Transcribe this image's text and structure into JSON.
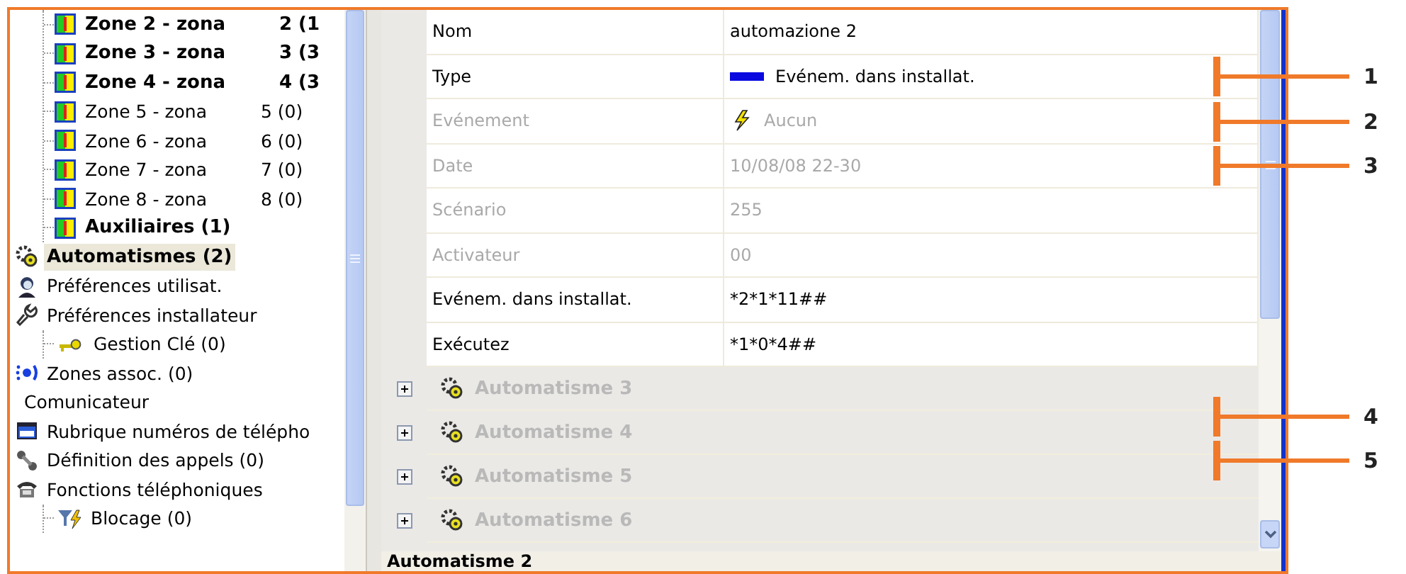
{
  "tree": {
    "continued_children": [
      {
        "label": "Zone 2 - zona",
        "count": "2 (1",
        "bold": true,
        "kind": "zone",
        "selected": false
      },
      {
        "label": "Zone 3 - zona",
        "count": "3 (3",
        "bold": true,
        "kind": "zone",
        "selected": false
      },
      {
        "label": "Zone 4 - zona",
        "count": "4 (3",
        "bold": true,
        "kind": "zone",
        "selected": false
      },
      {
        "label": "Zone 5 - zona",
        "count": "5 (0)",
        "bold": false,
        "kind": "zone",
        "selected": false
      },
      {
        "label": "Zone 6 - zona",
        "count": "6 (0)",
        "bold": false,
        "kind": "zone",
        "selected": false
      },
      {
        "label": "Zone 7 - zona",
        "count": "7 (0)",
        "bold": false,
        "kind": "zone",
        "selected": false
      },
      {
        "label": "Zone 8 - zona",
        "count": "8 (0)",
        "bold": false,
        "kind": "zone",
        "selected": false
      },
      {
        "label": "Auxiliaires (1)",
        "bold": true,
        "kind": "zone",
        "selected": false
      }
    ],
    "items": [
      {
        "label": "Automatismes (2)",
        "bold": true,
        "kind": "automation",
        "selected": true
      },
      {
        "label": "Préférences utilisat.",
        "bold": false,
        "kind": "user",
        "selected": false
      },
      {
        "label": "Préférences installateur",
        "bold": false,
        "kind": "wrench",
        "selected": false,
        "children": [
          {
            "label": "Gestion Clé (0)",
            "bold": false,
            "kind": "key",
            "selected": false
          }
        ]
      },
      {
        "label": "Zones assoc. (0)",
        "bold": false,
        "kind": "zones",
        "selected": false
      },
      {
        "label": "Comunicateur",
        "bold": false,
        "kind": "plain",
        "selected": false
      },
      {
        "label": "Rubrique numéros de télépho",
        "bold": false,
        "kind": "folder",
        "selected": false
      },
      {
        "label": "Définition des appels (0)",
        "bold": false,
        "kind": "calls",
        "selected": false
      },
      {
        "label": "Fonctions téléphoniques",
        "bold": false,
        "kind": "phone",
        "selected": false,
        "children": [
          {
            "label": "Blocage (0)",
            "bold": false,
            "kind": "filter",
            "selected": false
          }
        ]
      }
    ]
  },
  "properties": [
    {
      "label": "Nom",
      "value": "automazione 2",
      "kind": "text",
      "disabled": false
    },
    {
      "label": "Type",
      "value": "Evénem. dans installat.",
      "kind": "type",
      "disabled": false,
      "callout": "1"
    },
    {
      "label": "Evénement",
      "value": "Aucun",
      "kind": "event",
      "disabled": true,
      "callout": "2"
    },
    {
      "label": "Date",
      "value": "10/08/08 22-30",
      "kind": "text",
      "disabled": true,
      "callout": "3"
    },
    {
      "label": "Scénario",
      "value": "255",
      "kind": "text",
      "disabled": true
    },
    {
      "label": "Activateur",
      "value": "00",
      "kind": "text",
      "disabled": true
    },
    {
      "label": "Evénem. dans installat.",
      "value": "*2*1*11##",
      "kind": "text",
      "disabled": false
    },
    {
      "label": "Exécutez",
      "value": "*1*0*4##",
      "kind": "text",
      "disabled": false
    }
  ],
  "groups": [
    {
      "label": "Automatisme 3",
      "expanded": false,
      "disabled": true
    },
    {
      "label": "Automatisme 4",
      "expanded": false,
      "disabled": true,
      "callout": "4"
    },
    {
      "label": "Automatisme 5",
      "expanded": false,
      "disabled": true,
      "callout": "5"
    },
    {
      "label": "Automatisme 6",
      "expanded": false,
      "disabled": true
    }
  ],
  "footer": {
    "title": "Automatisme 2"
  }
}
